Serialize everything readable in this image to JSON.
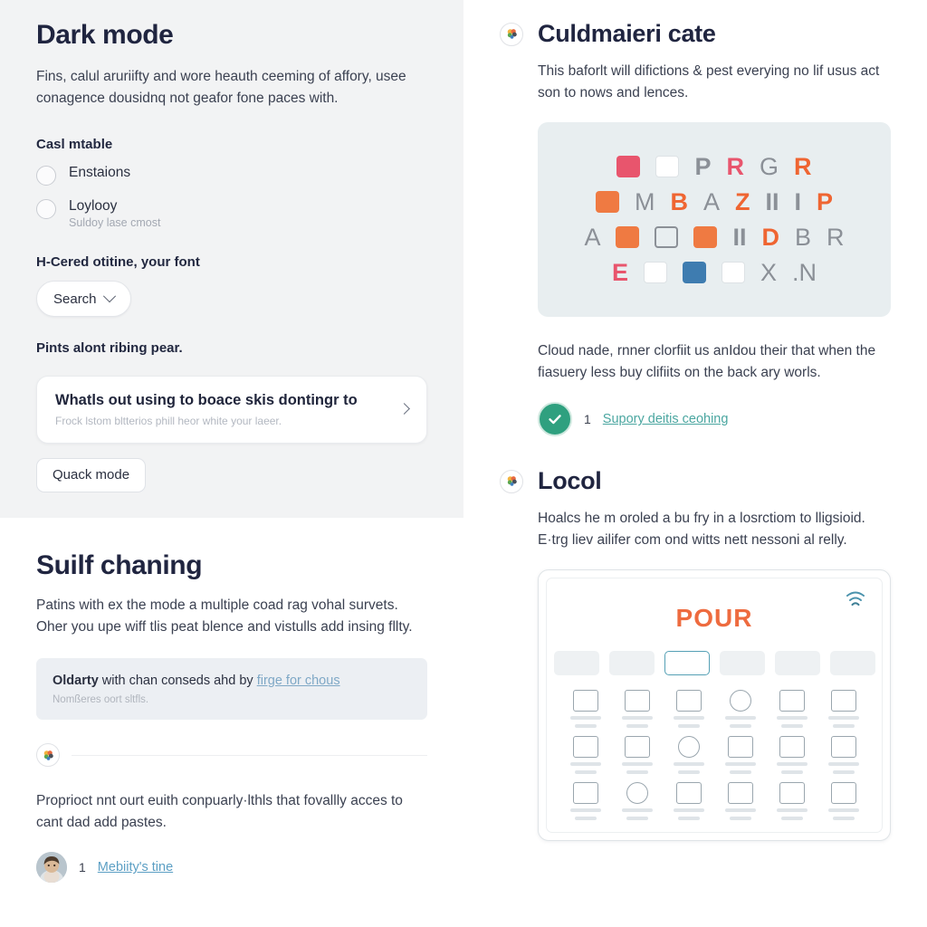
{
  "left": {
    "section_a": {
      "title": "Dark mode",
      "paragraph": "Fins, calul aruriifty and wore heauth ceeming of affory, usee conagence dousidnq not geafor fone paces with.",
      "group_label": "Casl mtable",
      "options": [
        {
          "label": "Enstaions",
          "help": ""
        },
        {
          "label": "Loylooy",
          "help": "Suldoy lase cmost"
        }
      ],
      "font_label": "H-Cered otitine, your font",
      "dropdown_value": "Search",
      "hint": "Pints alont ribing pear.",
      "card": {
        "title": "Whatls out using to boace skis dontingr to",
        "subtitle": "Frock lstom bltterios phill heor white your laeer."
      },
      "button": "Quack mode"
    },
    "section_b": {
      "title": "Suilf chaning",
      "paragraph": "Patins with ex the mode a multiple coad rag vohal survets. Oher you upe wiff tlis peat blence and vistulls add insing fllty.",
      "callout": {
        "strong": "Oldarty",
        "text": " with chan conseds ahd by ",
        "link": "firge for chous",
        "sub": "Nomßeres oort sltfls."
      },
      "footer_paragraph": "Proprioct nnt ourt euith conpuarly·lthls that fovallly acces to cant dad add pastes.",
      "meta": {
        "count": "1",
        "link": "Mebiity's tine"
      }
    }
  },
  "right": {
    "section_a": {
      "title": "Culdmaieri cate",
      "paragraph": "This baforlt will difictions & pest everying no lif usus act son to nows and lences.",
      "glyph_rows": [
        [
          {
            "kind": "sq",
            "tone": "r"
          },
          {
            "kind": "sq",
            "tone": "w"
          },
          {
            "kind": "ch",
            "text": "P",
            "tone": "grey"
          },
          {
            "kind": "ch",
            "text": "R",
            "tone": "red"
          },
          {
            "kind": "ch",
            "text": "G",
            "tone": "thin"
          },
          {
            "kind": "ch",
            "text": "R",
            "tone": "orange"
          }
        ],
        [
          {
            "kind": "sq",
            "tone": "o"
          },
          {
            "kind": "ch",
            "text": "M",
            "tone": "thin"
          },
          {
            "kind": "ch",
            "text": "B",
            "tone": "orange"
          },
          {
            "kind": "ch",
            "text": "A",
            "tone": "thin"
          },
          {
            "kind": "ch",
            "text": "Z",
            "tone": "orange"
          },
          {
            "kind": "ch",
            "text": "II",
            "tone": "grey"
          },
          {
            "kind": "ch",
            "text": "I",
            "tone": "grey"
          },
          {
            "kind": "ch",
            "text": "P",
            "tone": "orange"
          }
        ],
        [
          {
            "kind": "ch",
            "text": "A",
            "tone": "thin"
          },
          {
            "kind": "sq",
            "tone": "o"
          },
          {
            "kind": "sq",
            "tone": "out"
          },
          {
            "kind": "sq",
            "tone": "o"
          },
          {
            "kind": "ch",
            "text": "II",
            "tone": "grey"
          },
          {
            "kind": "ch",
            "text": "D",
            "tone": "orange"
          },
          {
            "kind": "ch",
            "text": "B",
            "tone": "thin"
          },
          {
            "kind": "ch",
            "text": "R",
            "tone": "thin"
          }
        ],
        [
          {
            "kind": "ch",
            "text": "E",
            "tone": "red"
          },
          {
            "kind": "sq",
            "tone": "w"
          },
          {
            "kind": "sq",
            "tone": "b"
          },
          {
            "kind": "sq",
            "tone": "w"
          },
          {
            "kind": "ch",
            "text": "X",
            "tone": "thin"
          },
          {
            "kind": "ch",
            "text": ".N",
            "tone": "thin"
          }
        ]
      ],
      "paragraph_below": "Cloud nade, rnner clorfiit us anIdou their that when the fiasuery less buy clifiits on the back ary worls.",
      "meta": {
        "count": "1",
        "link": "Supory deitis ceohing"
      }
    },
    "section_b": {
      "title": "Locol",
      "paragraph": "Hoalcs he m oroled a bu fry in a losrctiom to lligsioid. E·trg liev ailifer com ond witts nett nessoni al relly.",
      "mock": {
        "wordmark": "POUR"
      }
    }
  },
  "icons": {
    "badge": "palette-badge-icon",
    "chevron_down": "chevron-down-icon",
    "chevron_right": "chevron-right-icon",
    "check": "check-circle-icon",
    "wifi": "wifi-icon",
    "avatar": "user-avatar"
  },
  "colors": {
    "panel_tint": "#f2f3f4",
    "glyph_panel": "#e8eef0",
    "accent_orange": "#ef6532",
    "accent_red": "#e8556d",
    "success_green": "#2fa07f",
    "link_blue": "#5c9fc4",
    "link_teal": "#4aa6a0"
  }
}
